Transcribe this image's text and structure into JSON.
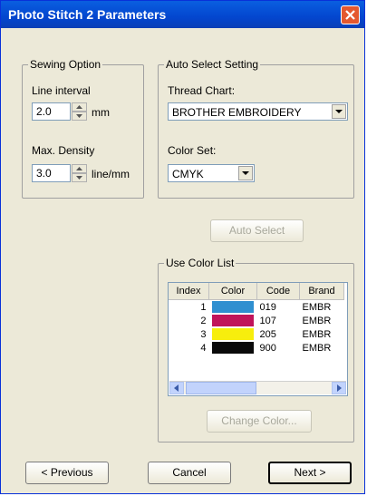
{
  "window": {
    "title": "Photo Stitch 2 Parameters"
  },
  "sewing_option": {
    "legend": "Sewing Option",
    "line_interval_label": "Line interval",
    "line_interval_value": "2.0",
    "line_interval_unit": "mm",
    "max_density_label": "Max. Density",
    "max_density_value": "3.0",
    "max_density_unit": "line/mm"
  },
  "auto_select": {
    "legend": "Auto Select Setting",
    "thread_chart_label": "Thread Chart:",
    "thread_chart_value": "BROTHER EMBROIDERY",
    "color_set_label": "Color Set:",
    "color_set_value": "CMYK",
    "auto_select_button": "Auto Select"
  },
  "use_color_list": {
    "legend": "Use Color List",
    "columns": [
      "Index",
      "Color",
      "Code",
      "Brand"
    ],
    "rows": [
      {
        "index": "1",
        "color": "#2f8fd0",
        "code": "019",
        "brand": "EMBR"
      },
      {
        "index": "2",
        "color": "#c0145a",
        "code": "107",
        "brand": "EMBR"
      },
      {
        "index": "3",
        "color": "#f7ee0d",
        "code": "205",
        "brand": "EMBR"
      },
      {
        "index": "4",
        "color": "#0a0a0a",
        "code": "900",
        "brand": "EMBR"
      }
    ],
    "change_color_button": "Change Color..."
  },
  "footer": {
    "previous_button": "< Previous",
    "cancel_button": "Cancel",
    "next_button": "Next >"
  }
}
